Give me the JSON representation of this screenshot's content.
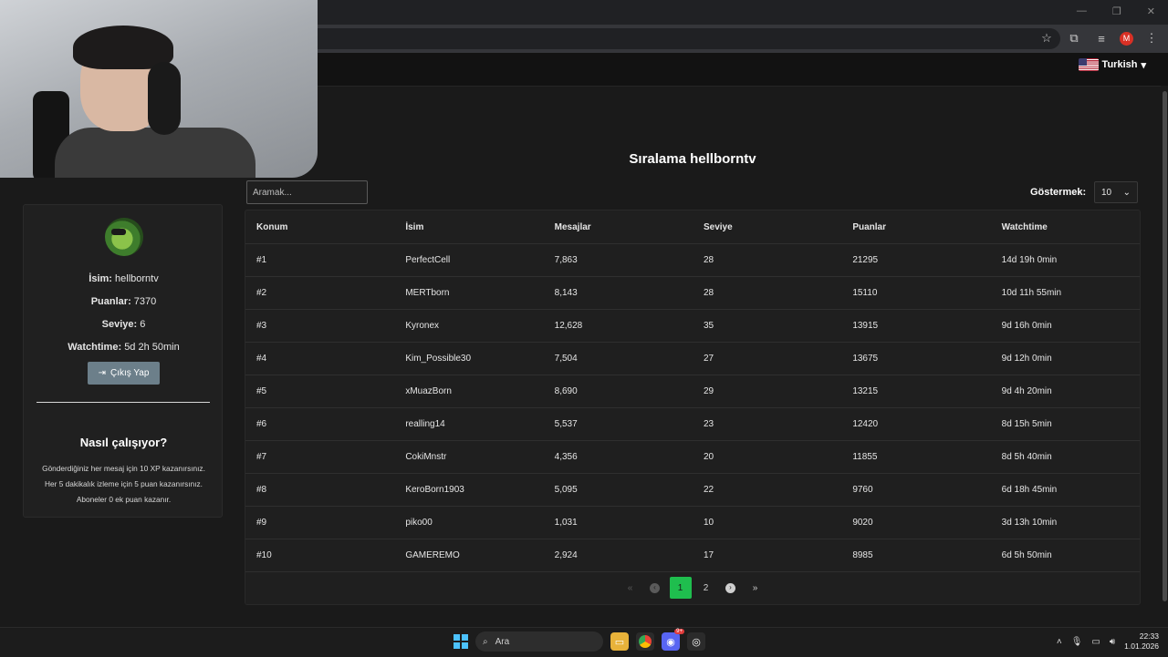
{
  "browser": {
    "language": "Turkish"
  },
  "sidebar": {
    "name_label": "İsim:",
    "name_value": "hellborntv",
    "points_label": "Puanlar:",
    "points_value": "7370",
    "level_label": "Seviye:",
    "level_value": "6",
    "watchtime_label": "Watchtime:",
    "watchtime_value": "5d 2h 50min",
    "logout_label": "Çıkış Yap",
    "how_title": "Nasıl çalışıyor?",
    "how_line1": "Gönderdiğiniz her mesaj için 10 XP kazanırsınız.",
    "how_line2": "Her 5 dakikalık izleme için 5 puan kazanırsınız.",
    "how_line3": "Aboneler 0 ek puan kazanır."
  },
  "main": {
    "title": "Sıralama hellborntv",
    "search_placeholder": "Aramak...",
    "show_label": "Göstermek:",
    "show_value": "10",
    "columns": [
      "Konum",
      "İsim",
      "Mesajlar",
      "Seviye",
      "Puanlar",
      "Watchtime"
    ],
    "rows": [
      [
        "#1",
        "PerfectCell",
        "7,863",
        "28",
        "21295",
        "14d 19h 0min"
      ],
      [
        "#2",
        "MERTborn",
        "8,143",
        "28",
        "15110",
        "10d 11h 55min"
      ],
      [
        "#3",
        "Kyronex",
        "12,628",
        "35",
        "13915",
        "9d 16h 0min"
      ],
      [
        "#4",
        "Kim_Possible30",
        "7,504",
        "27",
        "13675",
        "9d 12h 0min"
      ],
      [
        "#5",
        "xMuazBorn",
        "8,690",
        "29",
        "13215",
        "9d 4h 20min"
      ],
      [
        "#6",
        "realling14",
        "5,537",
        "23",
        "12420",
        "8d 15h 5min"
      ],
      [
        "#7",
        "CokiMnstr",
        "4,356",
        "20",
        "11855",
        "8d 5h 40min"
      ],
      [
        "#8",
        "KeroBorn1903",
        "5,095",
        "22",
        "9760",
        "6d 18h 45min"
      ],
      [
        "#9",
        "piko00",
        "1,031",
        "10",
        "9020",
        "3d 13h 10min"
      ],
      [
        "#10",
        "GAMEREMO",
        "2,924",
        "17",
        "8985",
        "6d 5h 50min"
      ]
    ],
    "pagination": {
      "first": "«",
      "prev": "‹",
      "pages": [
        "1",
        "2"
      ],
      "active_page": "1",
      "next": "›",
      "last": "»"
    }
  },
  "taskbar": {
    "search_label": "Ara",
    "discord_badge": "9+",
    "time": "22:33",
    "date": "1.01.2026"
  },
  "colors": {
    "accent_green": "#1fbe4e",
    "logout_button": "#6c7f8a",
    "background": "#1a1a1a"
  }
}
